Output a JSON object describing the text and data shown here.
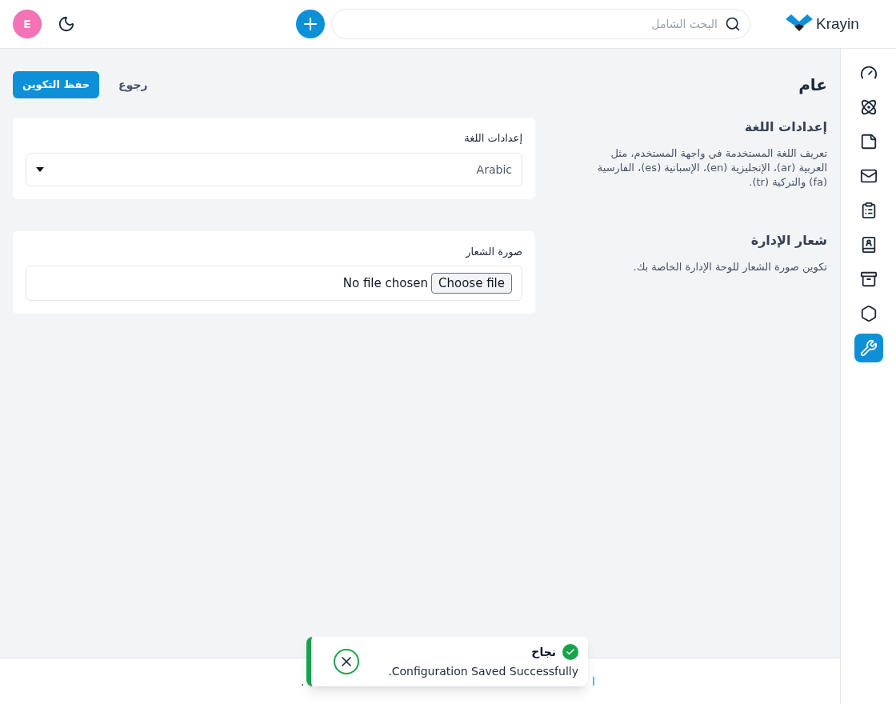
{
  "header": {
    "logo_text": "Krayin",
    "search": {
      "placeholder": "البحث الشامل"
    },
    "avatar": "E"
  },
  "sidebar": {
    "items": [
      {
        "kind": "gauge",
        "selected": false
      },
      {
        "kind": "atom",
        "selected": false
      },
      {
        "kind": "note",
        "selected": false
      },
      {
        "kind": "mail",
        "selected": false
      },
      {
        "kind": "clipboard",
        "selected": false
      },
      {
        "kind": "contacts",
        "selected": false
      },
      {
        "kind": "archive",
        "selected": false
      },
      {
        "kind": "hexagon",
        "selected": false
      },
      {
        "kind": "wrench",
        "selected": true
      }
    ]
  },
  "page": {
    "title": "عام",
    "back": "رجوع",
    "save": "حفظ التكوين"
  },
  "sections": [
    {
      "title": "إعدادات اللغة",
      "description": "تعريف اللغة المستخدمة في واجهة المستخدم، مثل العربية (ar)، الإنجليزية (en)، الإسبانية (es)، الفارسية (fa) والتركية (tr).",
      "field": {
        "kind": "select",
        "label": "إعدادات اللغة",
        "value": "Arabic"
      }
    },
    {
      "title": "شعار الإدارة",
      "description": "تكوين صورة الشعار للوحة الإدارة الخاصة بك.",
      "field": {
        "kind": "file",
        "label": "صورة الشعار",
        "button": "Choose file",
        "value": "No file chosen"
      }
    }
  ],
  "footer": {
    "link_fragment": "ا",
    "text_fragment": "."
  },
  "toast": {
    "title": "نجاح",
    "message": "Configuration Saved Successfully."
  }
}
